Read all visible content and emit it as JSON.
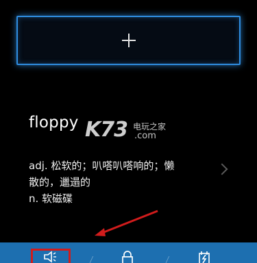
{
  "add_button": {
    "icon": "plus-icon"
  },
  "word": {
    "title": "floppy",
    "definition_lines": [
      "adj. 松软的；叭嗒叭嗒响的；懒",
      "散的，邋遢的",
      "n. 软磁碟"
    ]
  },
  "watermark": {
    "brand": "K73",
    "site_cn": "电玩之家",
    "domain": ".com"
  },
  "app_bar": {
    "buttons": [
      {
        "icon": "speaker-icon"
      },
      {
        "icon": "lock-icon"
      },
      {
        "icon": "calendar-check-icon"
      }
    ]
  },
  "colors": {
    "background": "#000000",
    "accent": "#2f8de0",
    "app_bar": "#1d6fb0",
    "annotation": "#d11c1c"
  }
}
